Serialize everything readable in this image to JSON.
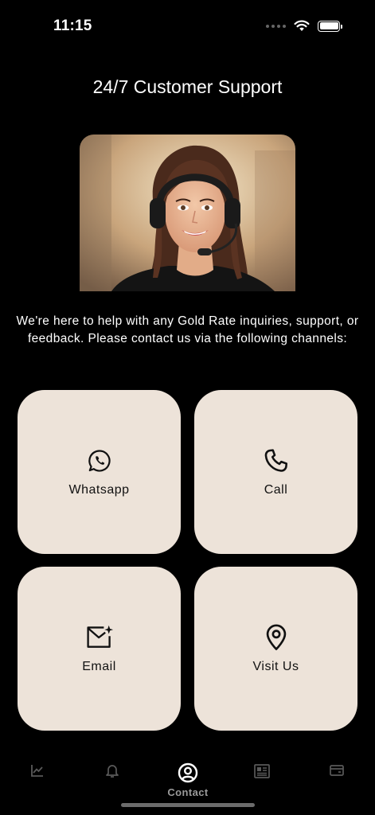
{
  "status_bar": {
    "time": "11:15"
  },
  "header": {
    "title": "24/7 Customer Support"
  },
  "intro": {
    "text": "We're here to help with any Gold Rate inquiries, support, or feedback. Please contact us via the following channels:"
  },
  "contact_options": [
    {
      "label": "Whatsapp",
      "icon": "whatsapp-icon"
    },
    {
      "label": "Call",
      "icon": "phone-icon"
    },
    {
      "label": "Email",
      "icon": "mail-sparkle-icon"
    },
    {
      "label": "Visit Us",
      "icon": "location-pin-icon"
    }
  ],
  "bottom_nav": {
    "items": [
      {
        "icon": "chart-icon",
        "label": ""
      },
      {
        "icon": "bell-icon",
        "label": ""
      },
      {
        "icon": "user-circle-icon",
        "label": "Contact",
        "active": true
      },
      {
        "icon": "newspaper-icon",
        "label": ""
      },
      {
        "icon": "wallet-icon",
        "label": ""
      }
    ]
  },
  "colors": {
    "background": "#000000",
    "card": "#ede3d9",
    "card_text": "#111111",
    "nav_inactive": "#5a5a5a",
    "nav_active": "#ffffff"
  }
}
